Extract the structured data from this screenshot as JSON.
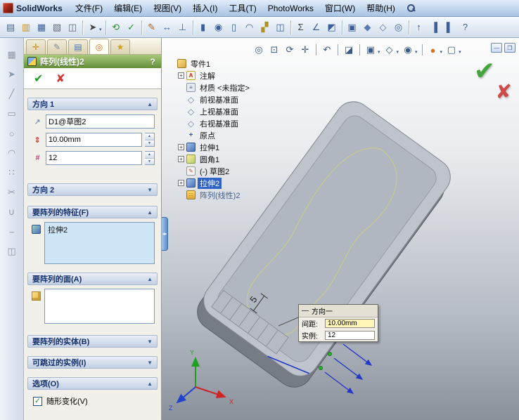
{
  "colors": {
    "selection_blue": "#2f63c8",
    "panel_title_green": "#618f38",
    "ok_green": "#1f9e1f",
    "cancel_red": "#d23434",
    "active_field_blue": "#cfe6f8"
  },
  "icons": {
    "chevron_up": "▲",
    "chevron_down": "▼",
    "plus": "+",
    "check": "✔",
    "cross": "✘",
    "small_check": "✓",
    "minimize": "—",
    "restore": "❐",
    "spin_up": "▲",
    "spin_down": "▼",
    "caret": "▾"
  },
  "window": {
    "app_title": "SolidWorks",
    "menus": [
      "文件(F)",
      "编辑(E)",
      "视图(V)",
      "插入(I)",
      "工具(T)",
      "PhotoWorks",
      "窗口(W)",
      "帮助(H)"
    ]
  },
  "top_toolbar": {
    "groups": [
      [
        {
          "name": "new-document-icon",
          "glyph": "▤",
          "color": "#49688f"
        },
        {
          "name": "open-document-icon",
          "glyph": "▥",
          "color": "#c09030"
        },
        {
          "name": "save-icon",
          "glyph": "▦",
          "color": "#3c5f9a"
        },
        {
          "name": "print-icon",
          "glyph": "▧",
          "color": "#5a6a7a"
        },
        {
          "name": "print-preview-icon",
          "glyph": "◫",
          "color": "#5a6a7a"
        }
      ],
      [
        {
          "name": "select-arrow-icon",
          "glyph": "➤",
          "color": "#444444",
          "caret": true
        }
      ],
      [
        {
          "name": "rebuild-icon",
          "glyph": "⟲",
          "color": "#2d8c2d"
        },
        {
          "name": "spell-check-icon",
          "glyph": "✓",
          "color": "#2d8c2d"
        }
      ],
      [
        {
          "name": "sketch-icon",
          "glyph": "✎",
          "color": "#a4601f"
        },
        {
          "name": "smart-dimension-icon",
          "glyph": "↔",
          "color": "#3c5f9a"
        },
        {
          "name": "add-relation-icon",
          "glyph": "⊥",
          "color": "#3c5f9a"
        }
      ],
      [
        {
          "name": "extrude-boss-icon",
          "glyph": "▮",
          "color": "#3c5f9a"
        },
        {
          "name": "revolve-icon",
          "glyph": "◉",
          "color": "#3c5f9a"
        },
        {
          "name": "extrude-cut-icon",
          "glyph": "▯",
          "color": "#3c5f9a"
        },
        {
          "name": "fillet-icon",
          "glyph": "◠",
          "color": "#3c5f9a"
        },
        {
          "name": "linear-pattern-icon",
          "glyph": "▞",
          "color": "#b09020"
        },
        {
          "name": "mirror-icon",
          "glyph": "◫",
          "color": "#3c5f9a"
        }
      ],
      [
        {
          "name": "equations-icon",
          "glyph": "Σ",
          "color": "#444444"
        },
        {
          "name": "measure-icon",
          "glyph": "∠",
          "color": "#3c5f9a"
        },
        {
          "name": "section-properties-icon",
          "glyph": "◩",
          "color": "#3c5f9a"
        }
      ],
      [
        {
          "name": "view-orientation-icon",
          "glyph": "▣",
          "color": "#3c5f9a"
        },
        {
          "name": "shaded-view-icon",
          "glyph": "◆",
          "color": "#5a7ab0"
        },
        {
          "name": "wireframe-view-icon",
          "glyph": "◇",
          "color": "#5a7ab0"
        },
        {
          "name": "zoom-tool-icon",
          "glyph": "◎",
          "color": "#3c5f9a"
        }
      ],
      [
        {
          "name": "arrow-up-icon",
          "glyph": "↑",
          "color": "#2255bb"
        },
        {
          "name": "task-pane-icon",
          "glyph": "▐",
          "color": "#3c5f9a"
        },
        {
          "name": "panel-toggle-icon",
          "glyph": "▌",
          "color": "#3c5f9a"
        },
        {
          "name": "app-help-icon",
          "glyph": "?",
          "color": "#3c5f9a"
        }
      ]
    ]
  },
  "left_toolbar": {
    "icons": [
      {
        "name": "sketch-grid-icon",
        "glyph": "▦"
      },
      {
        "name": "select-tool-icon",
        "glyph": "➤"
      },
      {
        "name": "line-tool-icon",
        "glyph": "╱"
      },
      {
        "name": "rectangle-tool-icon",
        "glyph": "▭"
      },
      {
        "name": "circle-tool-icon",
        "glyph": "○"
      },
      {
        "name": "arc-tool-icon",
        "glyph": "◠"
      },
      {
        "name": "point-pattern-icon",
        "glyph": "∷"
      },
      {
        "name": "trim-tool-icon",
        "glyph": "✂"
      },
      {
        "name": "hook-tool-icon",
        "glyph": "∪"
      },
      {
        "name": "spline-tool-icon",
        "glyph": "~"
      },
      {
        "name": "mirror-entities-icon",
        "glyph": "◫"
      }
    ]
  },
  "view_toolbar": {
    "icons": [
      {
        "name": "zoom-fit-icon",
        "glyph": "◎"
      },
      {
        "name": "zoom-area-icon",
        "glyph": "⊡"
      },
      {
        "name": "rotate-view-icon",
        "glyph": "⟳"
      },
      {
        "name": "pan-icon",
        "glyph": "✛"
      },
      {
        "name": "previous-view-icon",
        "glyph": "↶",
        "sep": true
      },
      {
        "name": "section-view-icon",
        "glyph": "◪",
        "sep": true
      },
      {
        "name": "view-orientation-hud-icon",
        "glyph": "▣",
        "sep": true,
        "caret": true
      },
      {
        "name": "display-style-icon",
        "glyph": "◇",
        "caret": true
      },
      {
        "name": "hide-show-items-icon",
        "glyph": "◉",
        "caret": true
      },
      {
        "name": "edit-appearance-icon",
        "glyph": "●",
        "color": "#d07828",
        "sep": true,
        "caret": true
      },
      {
        "name": "apply-scene-icon",
        "glyph": "▢",
        "caret": true
      }
    ]
  },
  "property_manager": {
    "tabs": [
      {
        "name": "tab-propertymanager",
        "glyph": "✛",
        "color": "#c08a20"
      },
      {
        "name": "tab-custom-properties",
        "glyph": "✎",
        "color": "#7a8aa0"
      },
      {
        "name": "tab-configurationmanager",
        "glyph": "▤",
        "color": "#4a72b8"
      },
      {
        "name": "tab-dimxpertmanager",
        "glyph": "◎",
        "color": "#d06a20",
        "active": true
      },
      {
        "name": "tab-displaymanager",
        "glyph": "★",
        "color": "#d0a020"
      }
    ],
    "title": "阵列(线性)2",
    "help": "?",
    "sections": [
      {
        "label": "方向 1",
        "expanded": true
      },
      {
        "label": "方向 2",
        "expanded": false
      },
      {
        "label": "要阵列的特征(F)",
        "expanded": true
      },
      {
        "label": "要阵列的面(A)",
        "expanded": true
      },
      {
        "label": "要阵列的实体(B)",
        "expanded": false
      },
      {
        "label": "可跳过的实例(I)",
        "expanded": false
      },
      {
        "label": "选项(O)",
        "expanded": true
      }
    ],
    "direction1": {
      "edge": "D1@草图2",
      "spacing": "10.00mm",
      "instances": "12",
      "icons": [
        {
          "name": "direction-reference-icon",
          "glyph": "↗"
        },
        {
          "name": "spacing-icon",
          "glyph": "⇕"
        },
        {
          "name": "instance-count-icon",
          "glyph": "#"
        }
      ]
    },
    "features_list": [
      "拉伸2"
    ],
    "options": {
      "vary_sketch": "随形变化(V)",
      "checked": true
    }
  },
  "feature_tree": {
    "rows": [
      {
        "label": "零件1",
        "icon": "part",
        "depth": 0
      },
      {
        "label": "注解",
        "icon": "annotations",
        "expander": true,
        "depth": 1
      },
      {
        "label": "材质 <未指定>",
        "icon": "material",
        "depth": 1
      },
      {
        "label": "前视基准面",
        "icon": "plane",
        "depth": 1
      },
      {
        "label": "上视基准面",
        "icon": "plane",
        "depth": 1
      },
      {
        "label": "右视基准面",
        "icon": "plane",
        "depth": 1
      },
      {
        "label": "原点",
        "icon": "origin",
        "depth": 1
      },
      {
        "label": "拉伸1",
        "icon": "extrude",
        "expander": true,
        "depth": 1
      },
      {
        "label": "圆角1",
        "icon": "fillet",
        "expander": true,
        "depth": 1
      },
      {
        "label": "(-) 草图2",
        "icon": "sketch",
        "depth": 1
      },
      {
        "label": "拉伸2",
        "icon": "extrude",
        "expander": true,
        "depth": 1,
        "selected": true
      },
      {
        "label": "阵列(线性)2",
        "icon": "pattern",
        "depth": 1,
        "pending": true
      }
    ]
  },
  "viewport": {
    "callout": {
      "title": "方向一",
      "rows": [
        {
          "label": "间距:",
          "value": "10.00mm"
        },
        {
          "label": "实例:",
          "value": "12"
        }
      ]
    },
    "dimension_label": "5",
    "triad_labels": {
      "x": "X",
      "y": "Y",
      "z": "Z"
    }
  }
}
